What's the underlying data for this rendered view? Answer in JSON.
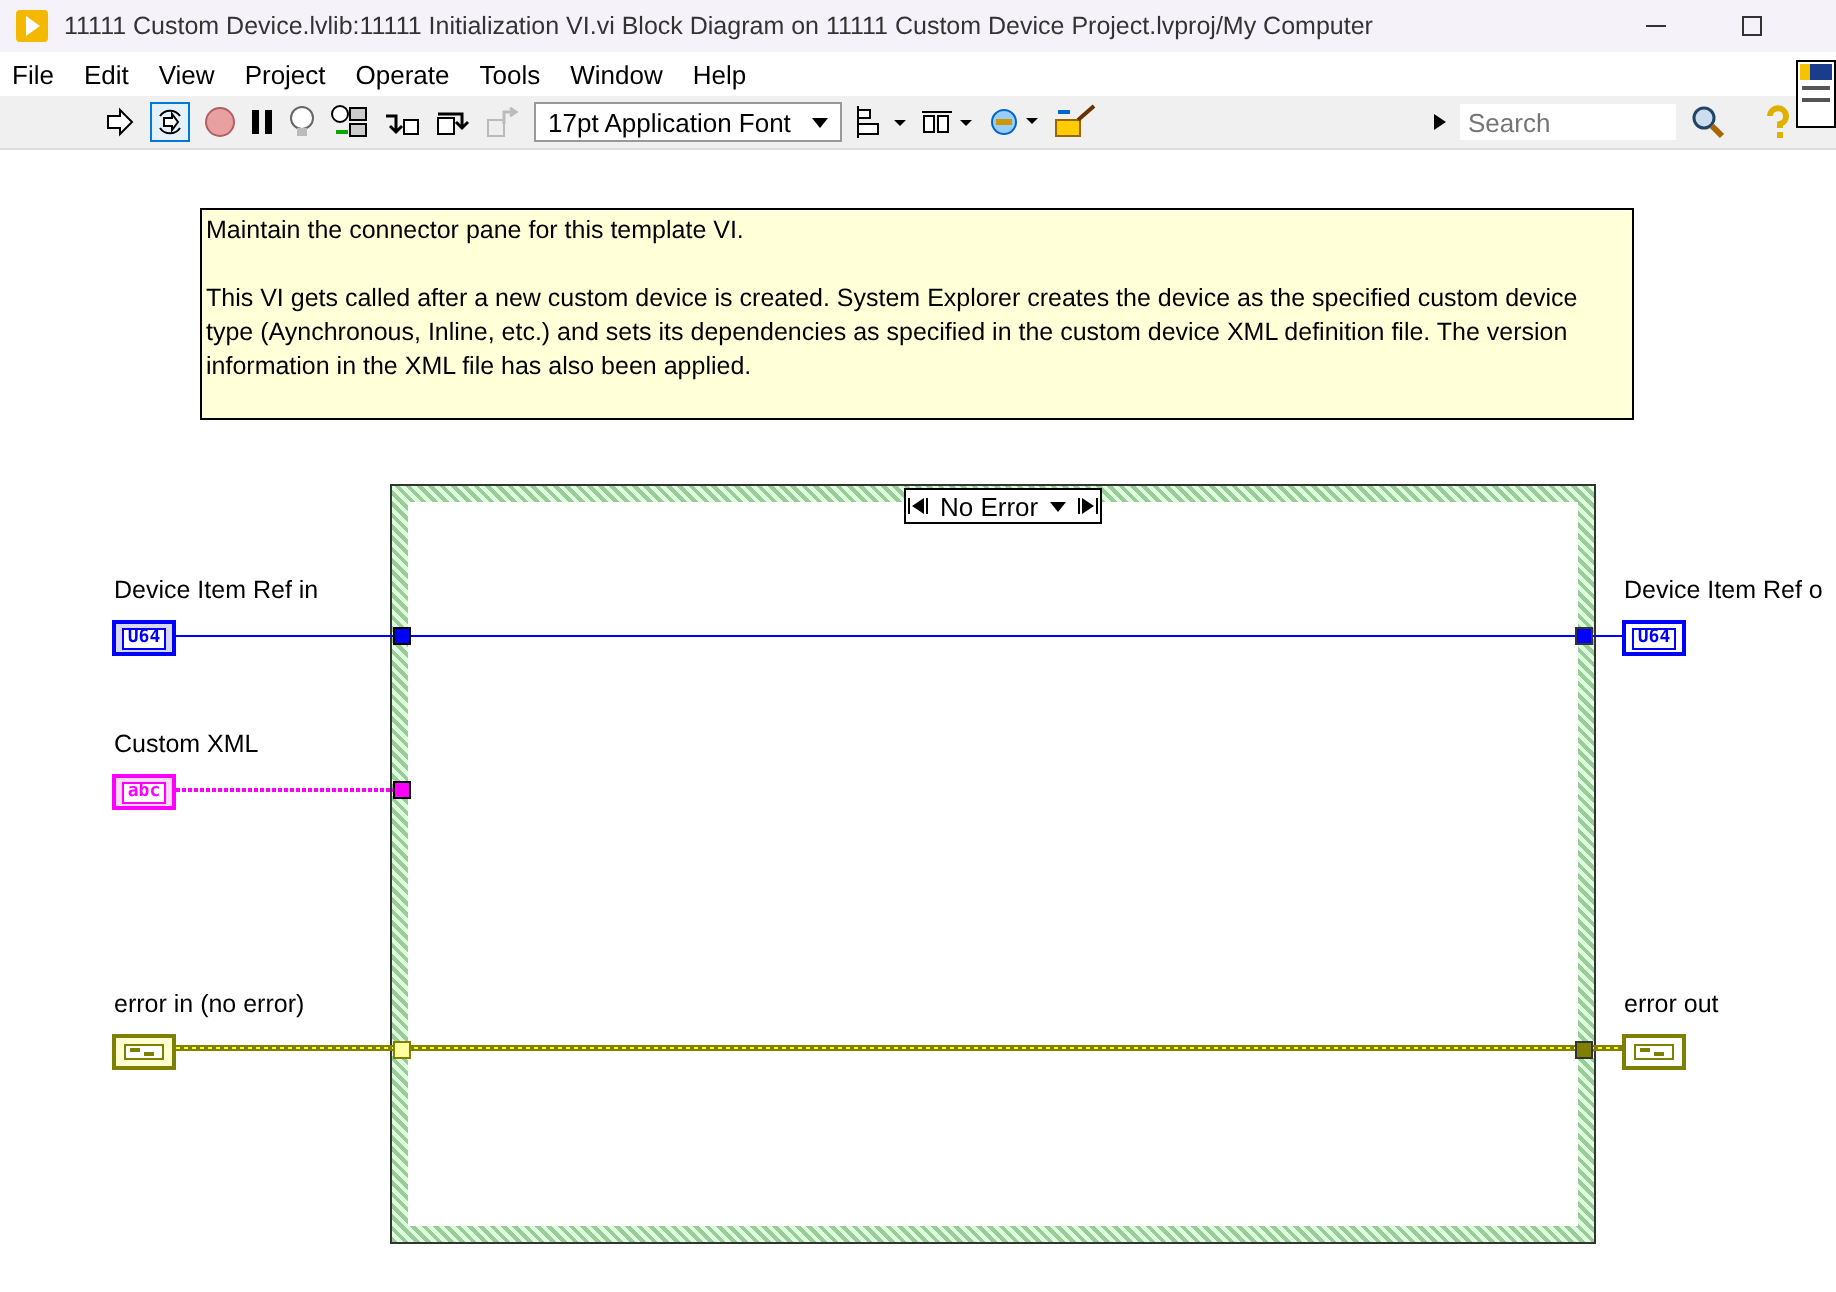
{
  "window": {
    "title": "11111 Custom Device.lvlib:11111 Initialization VI.vi Block Diagram on 11111 Custom Device Project.lvproj/My Computer"
  },
  "menu": [
    "File",
    "Edit",
    "View",
    "Project",
    "Operate",
    "Tools",
    "Window",
    "Help"
  ],
  "toolbar": {
    "font": "17pt Application Font",
    "search": {
      "placeholder": "Search"
    }
  },
  "diagram": {
    "comment": [
      "Maintain the connector pane for this template VI.",
      "This VI gets called after a new custom device is created. System Explorer creates the device as the specified custom device type (Aynchronous, Inline, etc.) and sets its dependencies as specified in the custom device XML definition file. The version information in the XML file has also been applied."
    ],
    "case_selector": "No Error",
    "inputs": [
      {
        "label": "Device Item Ref in",
        "kind": "numeric",
        "type_text": "U64"
      },
      {
        "label": "Custom XML",
        "kind": "string",
        "type_text": "abc"
      },
      {
        "label": "error in (no error)",
        "kind": "error"
      }
    ],
    "outputs": [
      {
        "label": "Device Item Ref o",
        "kind": "numeric",
        "type_text": "U64"
      },
      {
        "label": "error out",
        "kind": "error"
      }
    ]
  }
}
